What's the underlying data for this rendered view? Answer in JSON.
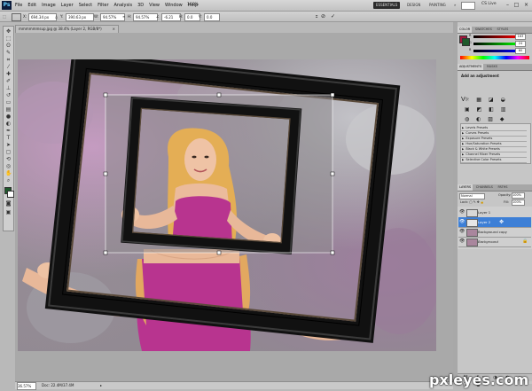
{
  "app": {
    "logo": "Ps",
    "menu": [
      "File",
      "Edit",
      "Image",
      "Layer",
      "Select",
      "Filter",
      "Analysis",
      "3D",
      "View",
      "Window",
      "Help"
    ],
    "zoom": "100%",
    "workspaces": [
      "ESSENTIALS",
      "DESIGN",
      "PAINTING"
    ],
    "cs_live": "CS Live"
  },
  "options": {
    "x": "694.34 px",
    "y": "390.63 px",
    "w": "94.57%",
    "h": "94.57%",
    "angle": "-6.21",
    "hskew": "0.0",
    "vskew": "0.0",
    "cancel": "⊘",
    "commit": "✓"
  },
  "document": {
    "tab": "mmmmmmsup.jpg @ 38.4% (Layer 2, RGB/8*)",
    "zoom": "36.57%",
    "info": "Doc: 22.4M/37.4M"
  },
  "panels": {
    "color_tabs": [
      "COLOR",
      "SWATCHES",
      "STYLES"
    ],
    "sliders": [
      {
        "label": "R",
        "value": "163",
        "color": "#d23a3a"
      },
      {
        "label": "G",
        "value": "24",
        "color": "#2ba64a"
      },
      {
        "label": "B",
        "value": "60",
        "color": "#3a5ad2"
      }
    ],
    "adj_tabs": [
      "ADJUSTMENTS",
      "MASKS"
    ],
    "adj_title": "Add an adjustment",
    "presets": [
      "Levels Presets",
      "Curves Presets",
      "Exposure Presets",
      "Hue/Saturation Presets",
      "Black & White Presets",
      "Channel Mixer Presets",
      "Selective Color Presets"
    ],
    "layer_tabs": [
      "LAYERS",
      "CHANNELS",
      "PATHS"
    ],
    "blend_mode": "Normal",
    "opacity_label": "Opacity:",
    "opacity": "100%",
    "fill_label": "Fill:",
    "fill": "100%",
    "layers": [
      {
        "name": "Layer 1",
        "selected": false
      },
      {
        "name": "Layer 2",
        "selected": true
      },
      {
        "name": "Background copy",
        "selected": false
      },
      {
        "name": "Background",
        "selected": false
      }
    ]
  },
  "watermark": "pxleyes.com",
  "colors": {
    "accent": "#3d7fd6",
    "fg_swatch": "#1f5a2c",
    "bg_swatch": "#ffffff",
    "dress": "#b8348f",
    "frame": "#111111"
  }
}
